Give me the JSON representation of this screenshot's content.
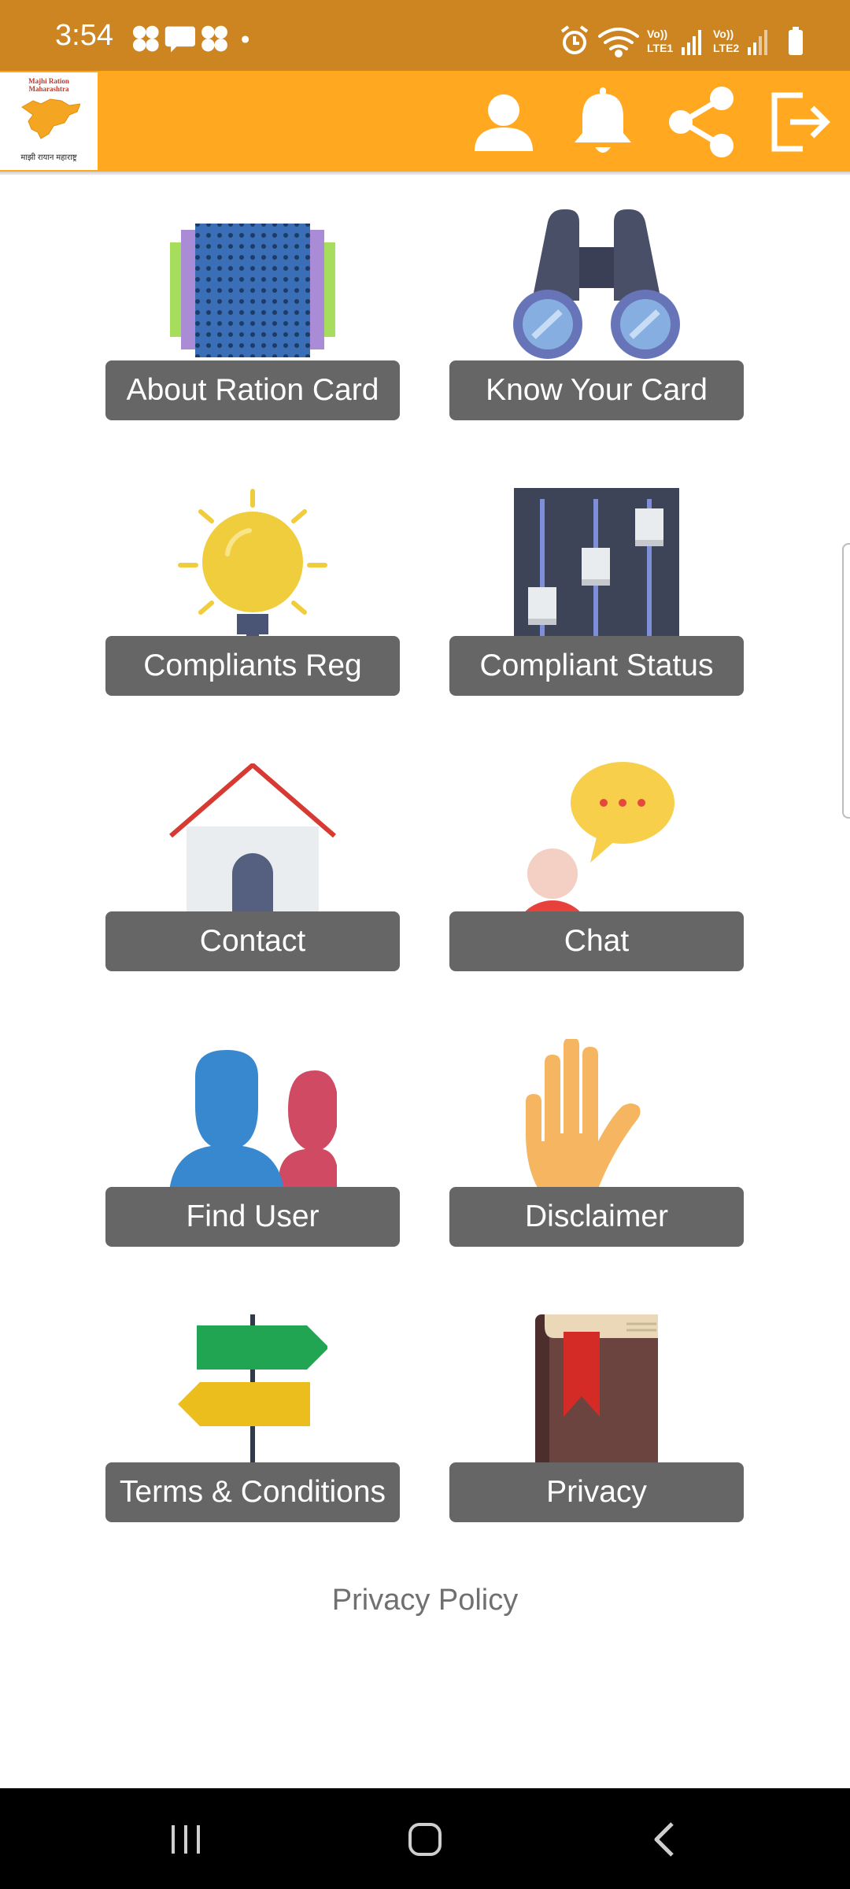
{
  "status_bar": {
    "time": "3:54",
    "left_icons": [
      "pinwheel-icon",
      "message-icon",
      "pinwheel-icon",
      "dot-icon"
    ],
    "right_icons": [
      "alarm-icon",
      "wifi-icon",
      "signal-sim1-icon",
      "signal-sim2-icon",
      "battery-icon"
    ],
    "sim1_label_top": "Vo))",
    "sim1_label_bottom": "LTE1",
    "sim2_label_top": "Vo))",
    "sim2_label_bottom": "LTE2"
  },
  "app_bar": {
    "logo_title_line1": "Majhi Ration",
    "logo_title_line2": "Maharashtra",
    "logo_caption": "माझी रायान महाराष्ट्र",
    "actions": [
      "profile-icon",
      "notification-bell-icon",
      "share-icon",
      "logout-icon"
    ]
  },
  "grid": {
    "items": [
      {
        "label": "About Ration Card",
        "icon": "ration-card-icon"
      },
      {
        "label": "Know Your Card",
        "icon": "binoculars-icon"
      },
      {
        "label": "Compliants Reg",
        "icon": "lightbulb-icon"
      },
      {
        "label": "Compliant Status",
        "icon": "sliders-icon"
      },
      {
        "label": "Contact",
        "icon": "house-icon"
      },
      {
        "label": "Chat",
        "icon": "chat-bubble-icon"
      },
      {
        "label": "Find User",
        "icon": "users-icon"
      },
      {
        "label": "Disclaimer",
        "icon": "hand-stop-icon"
      },
      {
        "label": "Terms & Conditions",
        "icon": "signpost-icon"
      },
      {
        "label": "Privacy",
        "icon": "book-icon"
      }
    ]
  },
  "footer": {
    "privacy_policy": "Privacy Policy"
  },
  "nav_bar": {
    "buttons": [
      "recent-apps-icon",
      "home-icon",
      "back-icon"
    ]
  },
  "colors": {
    "status_bar": "#cc8520",
    "app_bar": "#ffa820",
    "tile_button": "#666666",
    "footer_text": "#707070"
  }
}
